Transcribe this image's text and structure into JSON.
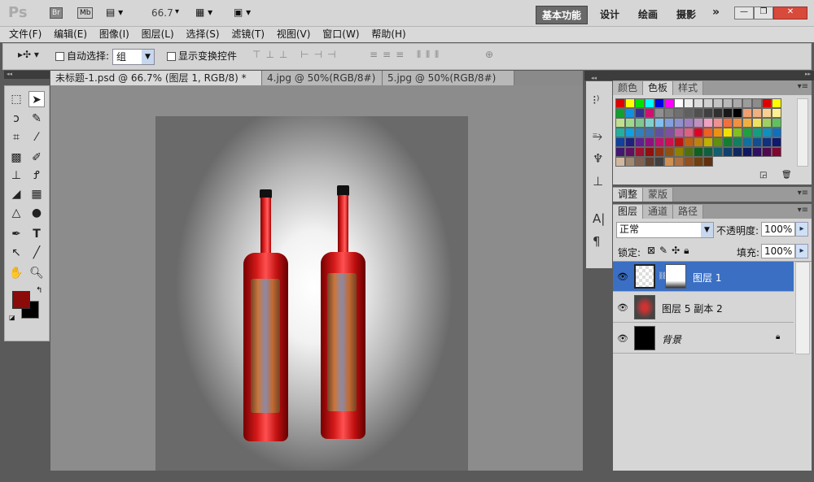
{
  "app": {
    "logo": "Ps",
    "br": "Br",
    "mb": "Mb",
    "zoom": "66.7"
  },
  "workspaces": [
    "基本功能",
    "设计",
    "绘画",
    "摄影"
  ],
  "more": "»",
  "window_controls": {
    "min": "—",
    "restore": "❐",
    "close": "✕"
  },
  "menu": [
    "文件(F)",
    "编辑(E)",
    "图像(I)",
    "图层(L)",
    "选择(S)",
    "滤镜(T)",
    "视图(V)",
    "窗口(W)",
    "帮助(H)"
  ],
  "options": {
    "auto_select_label": "自动选择:",
    "auto_select_value": "组",
    "show_transform": "显示变换控件"
  },
  "tabs": [
    {
      "label": "未标题-1.psd @ 66.7% (图层 1, RGB/8) *"
    },
    {
      "label": "4.jpg @ 50%(RGB/8#)"
    },
    {
      "label": "5.jpg @ 50%(RGB/8#)"
    }
  ],
  "color_panel": {
    "tabs": [
      "颜色",
      "色板",
      "样式"
    ]
  },
  "swatch_colors": [
    "#e00000",
    "#ffff00",
    "#00e000",
    "#00ffff",
    "#0000e0",
    "#ff00ff",
    "#ffffff",
    "#eeeeee",
    "#dddddd",
    "#d0d0d0",
    "#c4c4c4",
    "#b8b8b8",
    "#aaaaaa",
    "#9c9c9c",
    "#8c8c8c",
    "#e00000",
    "#ffff00",
    "#10a030",
    "#1090e0",
    "#303090",
    "#d01070",
    "#909090",
    "#808080",
    "#707070",
    "#606060",
    "#505050",
    "#404040",
    "#303030",
    "#181818",
    "#000000",
    "#f0a070",
    "#f0b080",
    "#f8d090",
    "#fff090",
    "#c0e090",
    "#a0d890",
    "#80c890",
    "#80d0d0",
    "#80c0f0",
    "#80a0e0",
    "#9090d0",
    "#a080c0",
    "#c090c0",
    "#f0a0c0",
    "#f09090",
    "#f07040",
    "#f09040",
    "#f0b040",
    "#f0e060",
    "#a0d060",
    "#60c060",
    "#20b0a0",
    "#10a0e0",
    "#3080c0",
    "#4070b0",
    "#6050a0",
    "#8050a0",
    "#c060a0",
    "#e06080",
    "#e00020",
    "#f06020",
    "#f09010",
    "#f0e000",
    "#80c020",
    "#20a040",
    "#10a080",
    "#1090c0",
    "#1070c0",
    "#1040a0",
    "#202080",
    "#602090",
    "#901080",
    "#c01070",
    "#d01050",
    "#c01010",
    "#c06010",
    "#c08010",
    "#c0b000",
    "#609010",
    "#108030",
    "#108060",
    "#1070a0",
    "#105090",
    "#103080",
    "#101870",
    "#401870",
    "#601060",
    "#a01030",
    "#901010",
    "#903010",
    "#905010",
    "#908000",
    "#507010",
    "#106020",
    "#106040",
    "#106070",
    "#104070",
    "#102860",
    "#101860",
    "#301060",
    "#500850",
    "#800830",
    "#d0b8a0",
    "#a08870",
    "#806050",
    "#604030",
    "#404040",
    "#d09050",
    "#b07040",
    "#905020",
    "#704010",
    "#603010"
  ],
  "adjust_panel": {
    "tabs": [
      "调整",
      "蒙版"
    ]
  },
  "layers_panel": {
    "tabs": [
      "图层",
      "通道",
      "路径"
    ],
    "blend_mode": "正常",
    "opacity_label": "不透明度:",
    "opacity": "100%",
    "lock_label": "锁定:",
    "fill_label": "填充:",
    "fill": "100%",
    "layers": [
      {
        "name": "图层 1",
        "selected": true
      },
      {
        "name": "图层 5 副本 2",
        "selected": false
      },
      {
        "name": "背景",
        "selected": false
      }
    ]
  },
  "tools_colors": {
    "foreground": "#8b0a0a",
    "background": "#000000"
  }
}
